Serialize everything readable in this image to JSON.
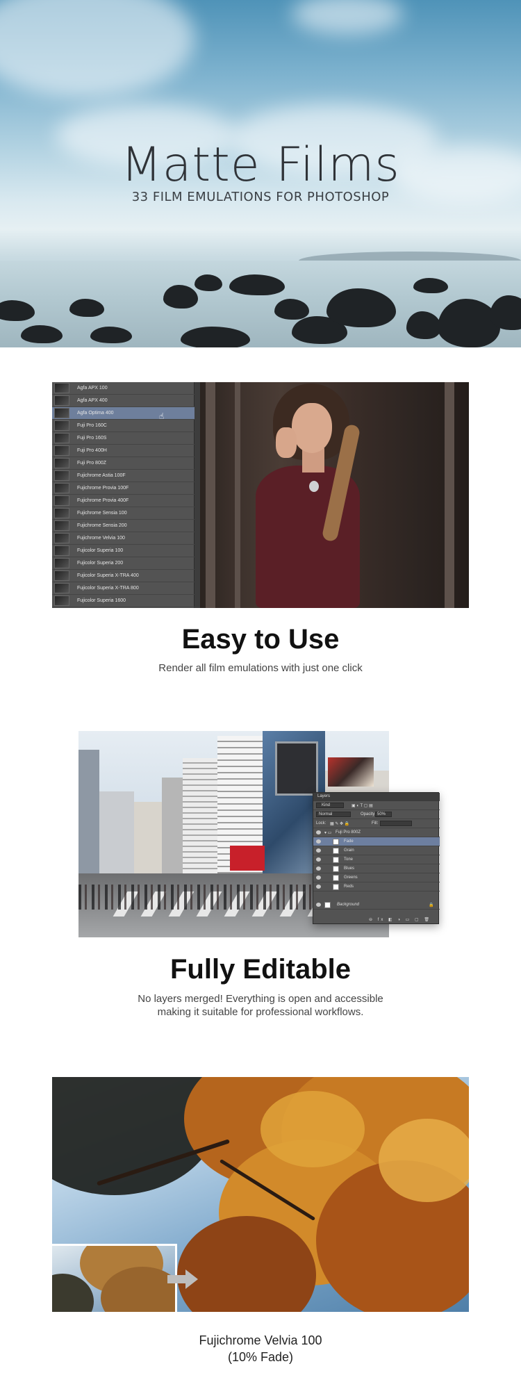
{
  "hero": {
    "title": "Matte Films",
    "subtitle": "33 FILM EMULATIONS FOR PHOTOSHOP"
  },
  "presets": [
    "Agfa APX 100",
    "Agfa APX 400",
    "Agfa Optima 400",
    "Fuji Pro 160C",
    "Fuji Pro 160S",
    "Fuji Pro 400H",
    "Fuji Pro 800Z",
    "Fujichrome Astia 100F",
    "Fujichrome Provia 100F",
    "Fujichrome Provia 400F",
    "Fujichrome Sensia 100",
    "Fujichrome Sensia 200",
    "Fujichrome Velvia 100",
    "Fujicolor Superia 100",
    "Fujicolor Superia 200",
    "Fujicolor Superia X-TRA 400",
    "Fujicolor Superia X-TRA 800",
    "Fujicolor Superia 1600"
  ],
  "presets_selected": "Agfa Optima 400",
  "section_easy": {
    "title": "Easy to Use",
    "description": "Render all film emulations with just one click"
  },
  "layers_panel": {
    "tab": "Layers",
    "kind": "Kind",
    "blend": "Normal",
    "opacity_label": "Opacity:",
    "opacity_value": "50%",
    "lock_label": "Lock:",
    "fill_label": "Fill:",
    "group": "Fuji Pro 800Z",
    "layers": [
      "Fade",
      "Grain",
      "Tone",
      "Blues",
      "Greens",
      "Reds"
    ],
    "selected_layer": "Fade",
    "background": "Background"
  },
  "section_editable": {
    "title": "Fully Editable",
    "description_line1": "No layers merged! Everything is open and accessible",
    "description_line2": "making it suitable for professional workflows."
  },
  "section_velvia": {
    "caption_line1": "Fujichrome Velvia 100",
    "caption_line2": "(10% Fade)"
  },
  "colors": {
    "accent_selection": "#6e7f9c",
    "panel_gray": "#535353",
    "text_dark": "#111111"
  }
}
